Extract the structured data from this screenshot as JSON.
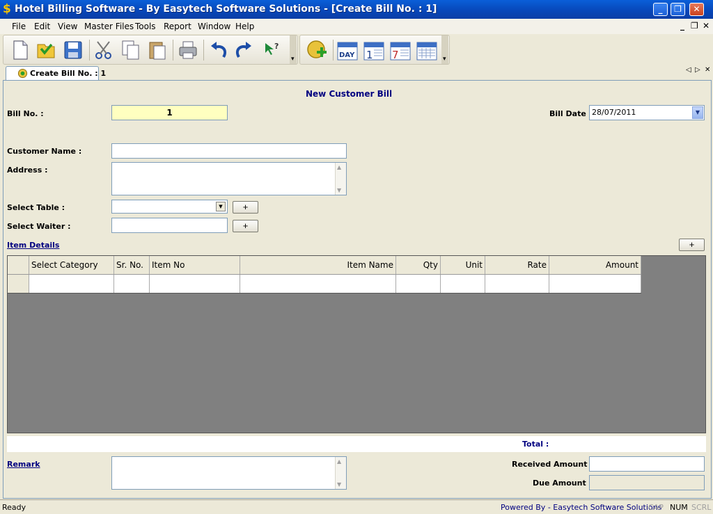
{
  "window": {
    "title": "Hotel Billing Software - By Easytech Software Solutions - [Create Bill No. : 1]",
    "app_icon": "$",
    "minimize": "_",
    "maximize": "❐",
    "close": "✕"
  },
  "menu": {
    "items": [
      "File",
      "Edit",
      "View",
      "Master Files",
      "Tools",
      "Report",
      "Window",
      "Help"
    ],
    "mdi_minimize": "_",
    "mdi_restore": "❐",
    "mdi_close": "✕"
  },
  "toolbar": {
    "icons": [
      "new-document-icon",
      "open-folder-icon",
      "save-icon",
      "cut-icon",
      "copy-icon",
      "paste-icon",
      "print-icon",
      "undo-icon",
      "redo-icon",
      "whats-this-icon",
      "add-coin-icon",
      "day-calendar-icon",
      "month-calendar-1-icon",
      "week-calendar-7-icon",
      "calendar-grid-icon"
    ],
    "day_label": "DAY",
    "cal1_label": "1",
    "cal7_label": "7"
  },
  "tab": {
    "label": "Create Bill No. : 1",
    "nav_prev": "◁",
    "nav_next": "▷",
    "nav_close": "✕"
  },
  "form": {
    "heading": "New Customer Bill",
    "bill_no_label": "Bill No. :",
    "bill_no_value": "1",
    "bill_date_label": "Bill Date :",
    "bill_date_value": "28/07/2011",
    "customer_name_label": "Customer Name :",
    "customer_name_value": "",
    "address_label": "Address :",
    "address_value": "",
    "select_table_label": "Select Table :",
    "select_table_value": "",
    "select_waiter_label": "Select Waiter :",
    "select_waiter_value": "",
    "plus": "+",
    "item_details_label": "Item Details",
    "total_label": "Total :",
    "remark_label": "Remark",
    "received_amount_label": "Received Amount :",
    "due_amount_label": "Due Amount :"
  },
  "grid": {
    "columns": [
      "Select Category",
      "Sr. No.",
      "Item No",
      "Item Name",
      "Qty",
      "Unit",
      "Rate",
      "Amount"
    ]
  },
  "status": {
    "ready": "Ready",
    "powered_by": "Powered By - Easytech Software Solutions",
    "cap": "CAP",
    "num": "NUM",
    "scrl": "SCRL"
  }
}
